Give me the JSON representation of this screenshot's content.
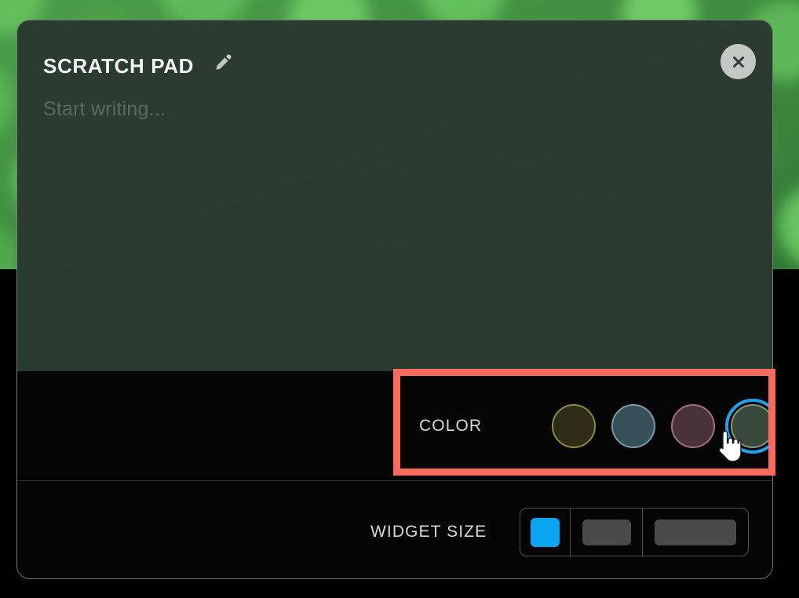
{
  "background": {
    "wallpaper_description": "blurred green leaves photo",
    "page_background_color": "#000000"
  },
  "panel": {
    "title": "SCRATCH PAD",
    "edit_icon": "pencil-icon",
    "close_icon": "close-x-icon",
    "surface_color": "#2d4234",
    "note": {
      "placeholder": "Start writing...",
      "value": ""
    }
  },
  "settings": {
    "color_row": {
      "label": "COLOR",
      "selected_index": 3,
      "selection_ring_color": "#1fa3f0",
      "swatches": [
        {
          "name": "olive",
          "fill": "#2e2b16",
          "border": "#8e8a3f"
        },
        {
          "name": "slate-blue",
          "fill": "#36505a",
          "border": "#7c9aa4"
        },
        {
          "name": "mauve",
          "fill": "#493238",
          "border": "#9b7180"
        },
        {
          "name": "forest-green",
          "fill": "#38493c",
          "border": "#7d9884"
        }
      ]
    },
    "size_row": {
      "label": "WIDGET SIZE",
      "selected_index": 0,
      "selected_color": "#0aa5f0",
      "unselected_color": "#4a4a4a",
      "options": [
        {
          "name": "small",
          "shape": "square"
        },
        {
          "name": "medium",
          "shape": "wide-rectangle"
        },
        {
          "name": "large",
          "shape": "extra-wide-rectangle"
        }
      ]
    }
  },
  "annotation": {
    "highlight_color": "#fb6b5b",
    "target": "color-row"
  }
}
